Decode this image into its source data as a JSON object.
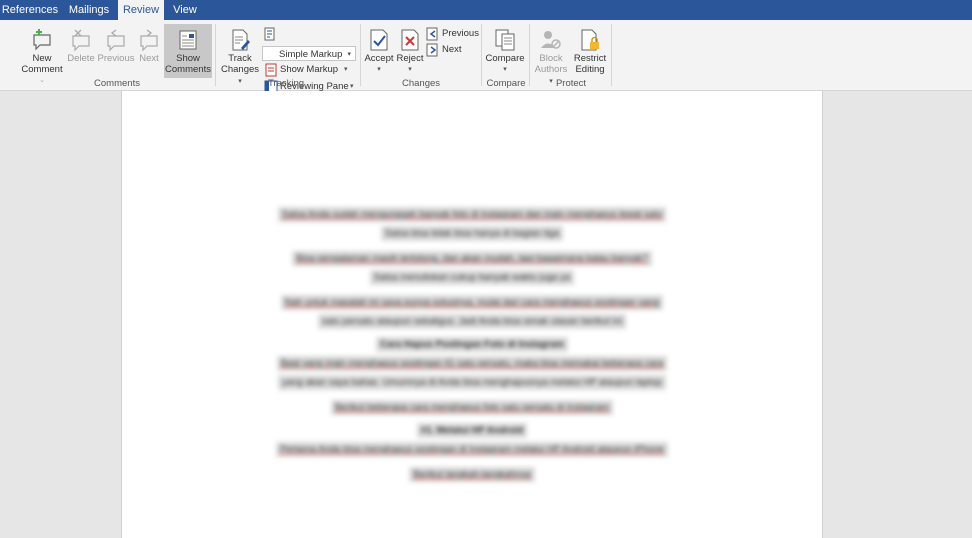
{
  "tabs": [
    {
      "label": "References",
      "active": false
    },
    {
      "label": "Mailings",
      "active": false
    },
    {
      "label": "Review",
      "active": true
    },
    {
      "label": "View",
      "active": false
    }
  ],
  "comments_group": {
    "label": "Comments",
    "new_comment": "New Comment",
    "delete": "Delete",
    "previous": "Previous",
    "next": "Next",
    "show_comments": "Show Comments"
  },
  "tracking_group": {
    "label": "Tracking",
    "track_changes": "Track Changes",
    "markup_select": "Simple Markup",
    "show_markup": "Show Markup",
    "reviewing_pane": "Reviewing Pane"
  },
  "changes_group": {
    "label": "Changes",
    "accept": "Accept",
    "reject": "Reject",
    "previous": "Previous",
    "next": "Next"
  },
  "compare_group": {
    "label": "Compare",
    "compare": "Compare"
  },
  "protect_group": {
    "label": "Protect",
    "block_authors": "Block Authors",
    "restrict_editing": "Restrict Editing"
  },
  "colors": {
    "tabbar": "#2b579a",
    "ribbon": "#f3f3f3",
    "accept_check": "#2b579a",
    "reject_x": "#d13438",
    "new_comment_plus": "#4caf50"
  },
  "document": {
    "blurred_paragraphs": [
      "Salsa Anda sudah mengunggah banyak foto di Instagram dan ingin menghapus lewat satu",
      "Salsa bisa tidak bisa hanya di bagian tiga",
      "Bisa pengalaman masih tertolong, dan akan mudah, tapi bagaimana kalau banyak?",
      "Salsa menuliskan cukup banyak waktu juga ya",
      "Nah untuk masalah ini saya punya solusinya, mulai dari cara menghapus postingan yang",
      "satu persatu ataupun sekaligus. Jadi Anda bisa simak ulasan berikut ini",
      "Cara Hapus Postingan Foto di Instagram",
      "Bagi yang ingin menghapus postingan IG satu persatu, maka bisa memakai beberapa cara",
      "yang akan saya bahas. Umumnya di Anda bisa menghapusnya melalui HP ataupun laptop",
      "Berikut beberapa cara menghapus foto satu persatu di Instagram",
      "#1. Melalui HP Android",
      "Pertama Anda bisa menghapus postingan di Instagram melalui HP Android ataupun iPhone",
      "Berikut langkah-langkahnya"
    ]
  }
}
